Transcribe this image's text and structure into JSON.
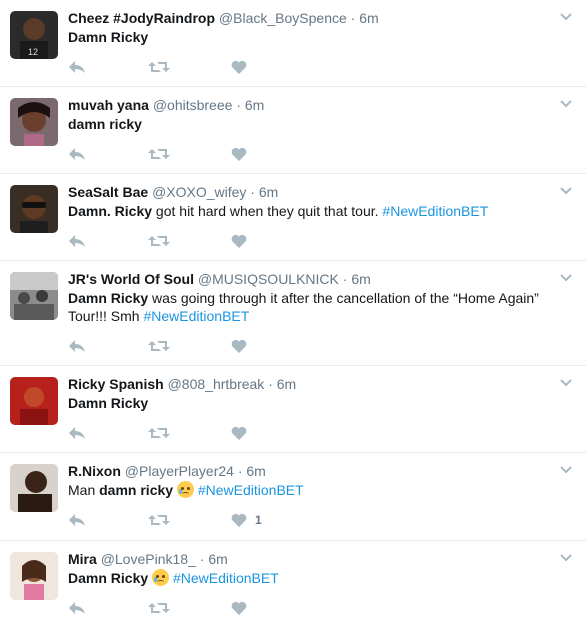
{
  "tweets": [
    {
      "name": "Cheez #JodyRaindrop",
      "handle": "@Black_BoySpence",
      "time": "6m",
      "text_bold": "Damn Ricky",
      "text_rest": "",
      "hashtag": "",
      "like_count": ""
    },
    {
      "name": "muvah yana",
      "handle": "@ohitsbreee",
      "time": "6m",
      "text_bold": "damn ricky",
      "text_rest": "",
      "hashtag": "",
      "like_count": ""
    },
    {
      "name": "SeaSalt Bae",
      "handle": "@XOXO_wifey",
      "time": "6m",
      "text_bold": "Damn. Ricky",
      "text_rest": " got hit hard when they quit that tour. ",
      "hashtag": "#NewEditionBET",
      "like_count": ""
    },
    {
      "name": "JR's World Of Soul",
      "handle": "@MUSIQSOULKNICK",
      "time": "6m",
      "text_bold": "Damn Ricky",
      "text_rest": " was going through it after the cancellation of the “Home Again” Tour!!! Smh ",
      "hashtag": "#NewEditionBET",
      "like_count": ""
    },
    {
      "name": "Ricky Spanish",
      "handle": "@808_hrtbreak",
      "time": "6m",
      "text_bold": "Damn Ricky",
      "text_rest": "",
      "hashtag": "",
      "like_count": ""
    },
    {
      "name": "R.Nixon",
      "handle": "@PlayerPlayer24",
      "time": "6m",
      "text_pre": "Man ",
      "text_bold": "damn ricky",
      "text_rest": " ",
      "hashtag": "#NewEditionBET",
      "like_count": "1"
    },
    {
      "name": "Mira",
      "handle": "@LovePink18_",
      "time": "6m",
      "text_bold": "Damn Ricky",
      "text_rest": " ",
      "hashtag": "#NewEditionBET",
      "like_count": ""
    }
  ],
  "separator": "·",
  "icons": {
    "reply": "reply-icon",
    "retweet": "retweet-icon",
    "like": "heart-icon",
    "more": "chevron-down-icon",
    "emoji": "crying-face-emoji"
  },
  "colors": {
    "hashtag": "#1b95e0",
    "muted": "#657786",
    "action_icon": "#aab8c2"
  }
}
